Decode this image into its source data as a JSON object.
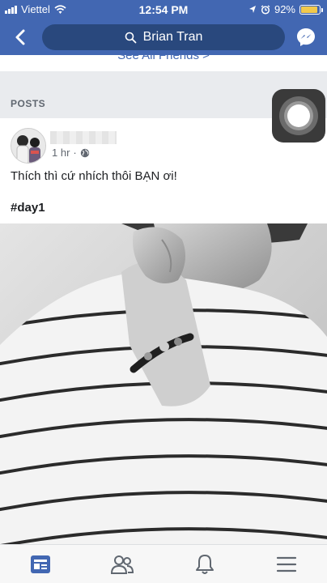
{
  "status_bar": {
    "carrier": "Viettel",
    "time": "12:54 PM",
    "battery_percent": "92%",
    "battery_level": 0.92,
    "icons": [
      "signal-icon",
      "wifi-icon",
      "location-icon",
      "alarm-icon",
      "battery-icon"
    ]
  },
  "nav": {
    "search_text": "Brian Tran",
    "icons": [
      "back-icon",
      "search-icon",
      "messenger-icon"
    ]
  },
  "friends_link": "See All Friends >",
  "posts_section": {
    "label": "POSTS"
  },
  "post": {
    "time_ago": "1 hr",
    "separator": "·",
    "text": "Thích thì cứ nhích thôi BẠN ơi!",
    "hashtag": "#day1",
    "privacy_icon": "globe-icon"
  },
  "tab_bar": {
    "tabs": [
      "news-feed-icon",
      "friends-icon",
      "notifications-icon",
      "menu-icon"
    ],
    "active_tab": "news-feed-icon"
  },
  "colors": {
    "brand": "#4267b2",
    "brand_dark": "#29487d",
    "background": "#e9ebee",
    "text": "#1c1e21",
    "muted": "#616770"
  }
}
